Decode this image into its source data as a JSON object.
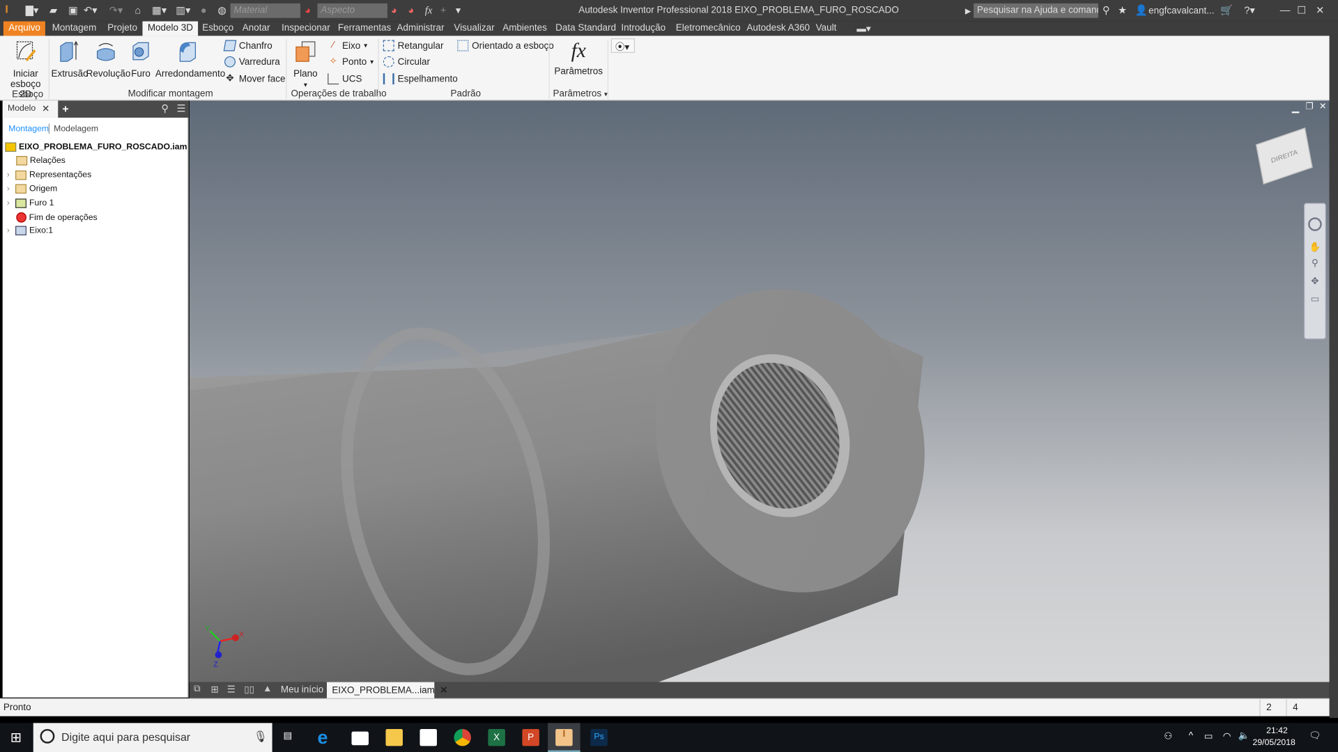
{
  "titlebar": {
    "app_title": "Autodesk Inventor Professional 2018   EIXO_PROBLEMA_FURO_ROSCADO",
    "material_placeholder": "Material",
    "appearance_placeholder": "Aspecto",
    "help_search": "Pesquisar na Ajuda e comandos...",
    "user": "engfcavalcant...",
    "logo_text": "PRO"
  },
  "menu": {
    "tabs": [
      "Arquivo",
      "Montagem",
      "Projeto",
      "Modelo 3D",
      "Esboço",
      "Anotar",
      "Inspecionar",
      "Ferramentas",
      "Administrar",
      "Visualizar",
      "Ambientes",
      "Data Standard",
      "Introdução",
      "Eletromecânico",
      "Autodesk A360",
      "Vault"
    ],
    "active": "Modelo 3D"
  },
  "ribbon": {
    "sketch": {
      "button": "Iniciar esboço 2D",
      "group": "Esboço"
    },
    "modify": {
      "extrude": "Extrusão",
      "revolve": "Revolução",
      "hole": "Furo",
      "fillet": "Arredondamento",
      "chamfer": "Chanfro",
      "sweep": "Varredura",
      "move_face": "Mover face",
      "group": "Modificar montagem"
    },
    "work": {
      "plane": "Plano",
      "axis": "Eixo",
      "point": "Ponto",
      "ucs": "UCS",
      "group": "Operações de trabalho"
    },
    "pattern": {
      "rect": "Retangular",
      "circular": "Circular",
      "mirror": "Espelhamento",
      "sketch_driven": "Orientado a esboço",
      "group": "Padrão"
    },
    "params": {
      "button": "Parâmetros",
      "group": "Parâmetros",
      "icon_text": "fx"
    }
  },
  "panel": {
    "tab": "Modelo",
    "add": "+",
    "views": [
      "Montagem",
      "Modelagem"
    ],
    "tree": [
      {
        "label": "EIXO_PROBLEMA_FURO_ROSCADO.iam",
        "icon": "assembly-icon",
        "expandable": false
      },
      {
        "label": "Relações",
        "icon": "folder-icon",
        "expandable": false
      },
      {
        "label": "Representações",
        "icon": "representations-icon",
        "expandable": true
      },
      {
        "label": "Origem",
        "icon": "folder-icon",
        "expandable": true
      },
      {
        "label": "Furo 1",
        "icon": "hole-feature-icon",
        "expandable": true
      },
      {
        "label": "Fim de operações",
        "icon": "end-of-features-icon",
        "expandable": false
      },
      {
        "label": "Eixo:1",
        "icon": "part-icon",
        "expandable": true
      }
    ]
  },
  "viewport": {
    "viewcube_label": "DIREITA",
    "triad": {
      "x": "X",
      "y": "Y",
      "z": "Z"
    }
  },
  "doctabs": {
    "home": "Meu início",
    "active": "EIXO_PROBLEMA...iam"
  },
  "status": {
    "text": "Pronto",
    "count1": "2",
    "count2": "4"
  },
  "taskbar": {
    "search_placeholder": "Digite aqui para pesquisar",
    "time": "21:42",
    "date": "29/05/2018",
    "apps": [
      "task-view",
      "edge",
      "movies",
      "explorer",
      "store",
      "chrome",
      "excel",
      "powerpoint",
      "inventor",
      "photoshop"
    ]
  },
  "colors": {
    "accent": "#f08321",
    "active_link": "#1e90ff"
  }
}
